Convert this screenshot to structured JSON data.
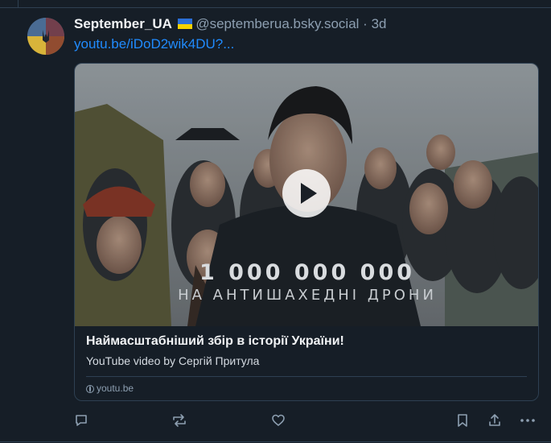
{
  "post": {
    "author_name": "September_UA",
    "author_flag_icon": "ukraine-flag-icon",
    "handle": "@septemberua.bsky.social",
    "separator": "·",
    "time": "3d",
    "link_text": "youtu.be/iDoD2wik4DU?..."
  },
  "embed": {
    "overlay_number": "1 000 000 000",
    "overlay_subtitle": "НА АНТИШАХЕДНІ ДРОНИ",
    "title": "Наймасштабніший збір в історії України!",
    "description": "YouTube video by Сергій Притула",
    "domain": "youtu.be"
  },
  "actions": [
    "reply-icon",
    "repost-icon",
    "like-icon",
    "bookmark-icon",
    "share-icon",
    "more-icon"
  ],
  "colors": {
    "background": "#161e27",
    "link": "#208bfe",
    "muted_text": "#8d9fb1",
    "border": "#2e4052"
  }
}
